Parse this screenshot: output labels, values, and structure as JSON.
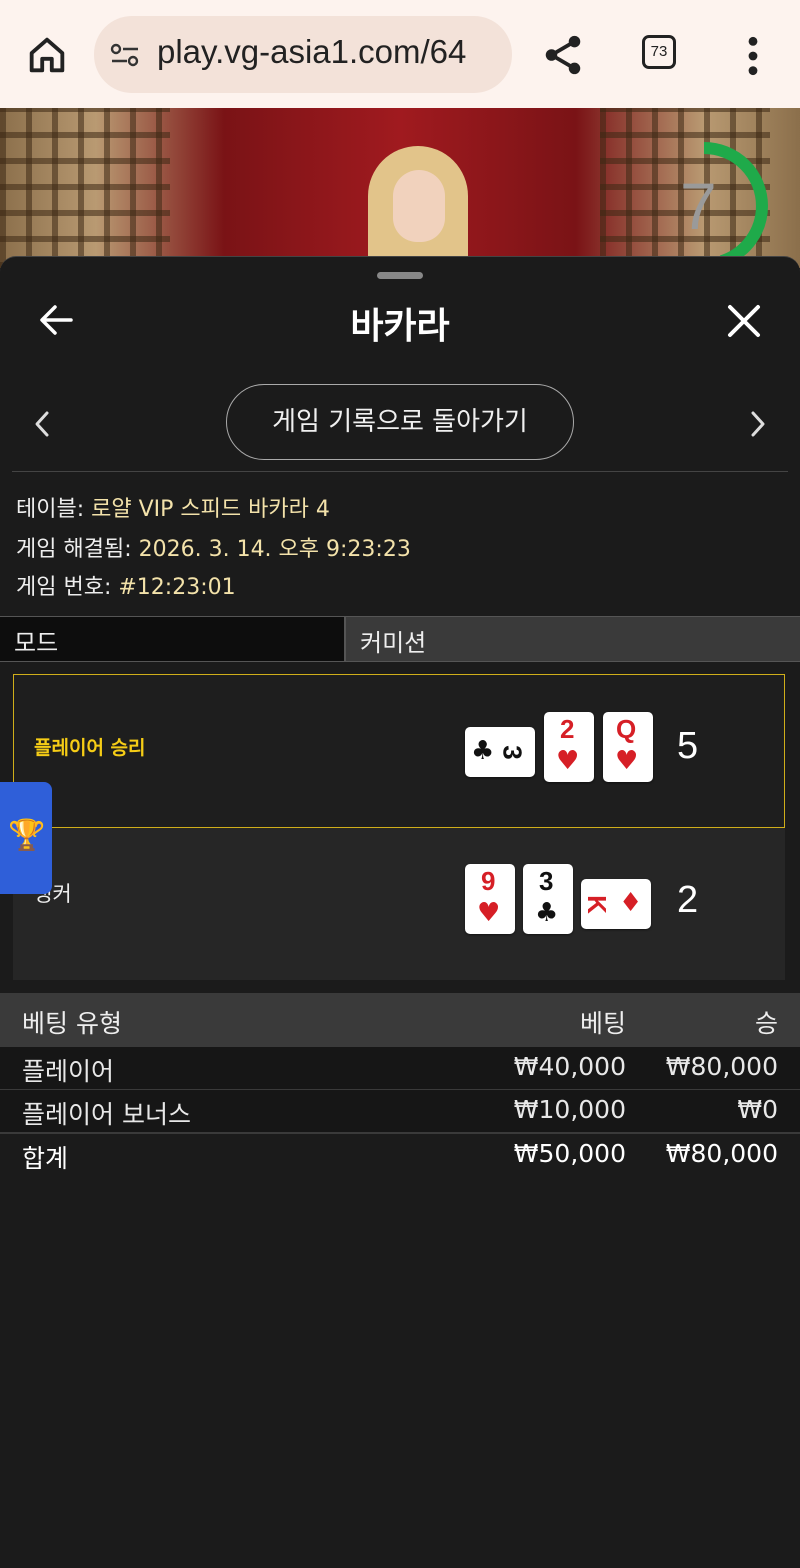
{
  "browser": {
    "url": "play.vg-asia1.com/64",
    "tab_count": "73"
  },
  "video": {
    "timer": "7",
    "timer_progress": 0.45
  },
  "sheet": {
    "title": "바카라",
    "return_button": "게임 기록으로 돌아가기"
  },
  "info": {
    "table_label": "테이블:",
    "table_value": "로얄 VIP 스피드 바카라 4",
    "resolved_label": "게임 해결됨:",
    "resolved_value": "2026. 3. 14. 오후 9:23:23",
    "number_label": "게임 번호:",
    "number_value": "#12:23:01"
  },
  "mode": {
    "label": "모드",
    "value": "커미션"
  },
  "hands": {
    "player": {
      "label": "플레이어 승리",
      "score": "5",
      "cards": [
        {
          "rank": "3",
          "suit": "♣",
          "color": "#111111",
          "sideways": true
        },
        {
          "rank": "2",
          "suit": "♥",
          "color": "#d61f26",
          "sideways": false
        },
        {
          "rank": "Q",
          "suit": "♥",
          "color": "#d61f26",
          "sideways": false
        }
      ]
    },
    "banker": {
      "label": "뱅커",
      "score": "2",
      "cards": [
        {
          "rank": "9",
          "suit": "♥",
          "color": "#d61f26",
          "sideways": false
        },
        {
          "rank": "3",
          "suit": "♣",
          "color": "#111111",
          "sideways": false
        },
        {
          "rank": "K",
          "suit": "♦",
          "color": "#d61f26",
          "sideways": true
        }
      ]
    }
  },
  "bets": {
    "headers": {
      "type": "베팅 유형",
      "bet": "베팅",
      "win": "승"
    },
    "rows": [
      {
        "type": "플레이어",
        "bet": "₩40,000",
        "win": "₩80,000"
      },
      {
        "type": "플레이어 보너스",
        "bet": "₩10,000",
        "win": "₩0"
      }
    ],
    "total": {
      "type": "합계",
      "bet": "₩50,000",
      "win": "₩80,000"
    }
  },
  "colors": {
    "accent_gold": "#f6cd16",
    "timer_green": "#1faa4a",
    "trophy_tab": "#2f5fd9"
  }
}
